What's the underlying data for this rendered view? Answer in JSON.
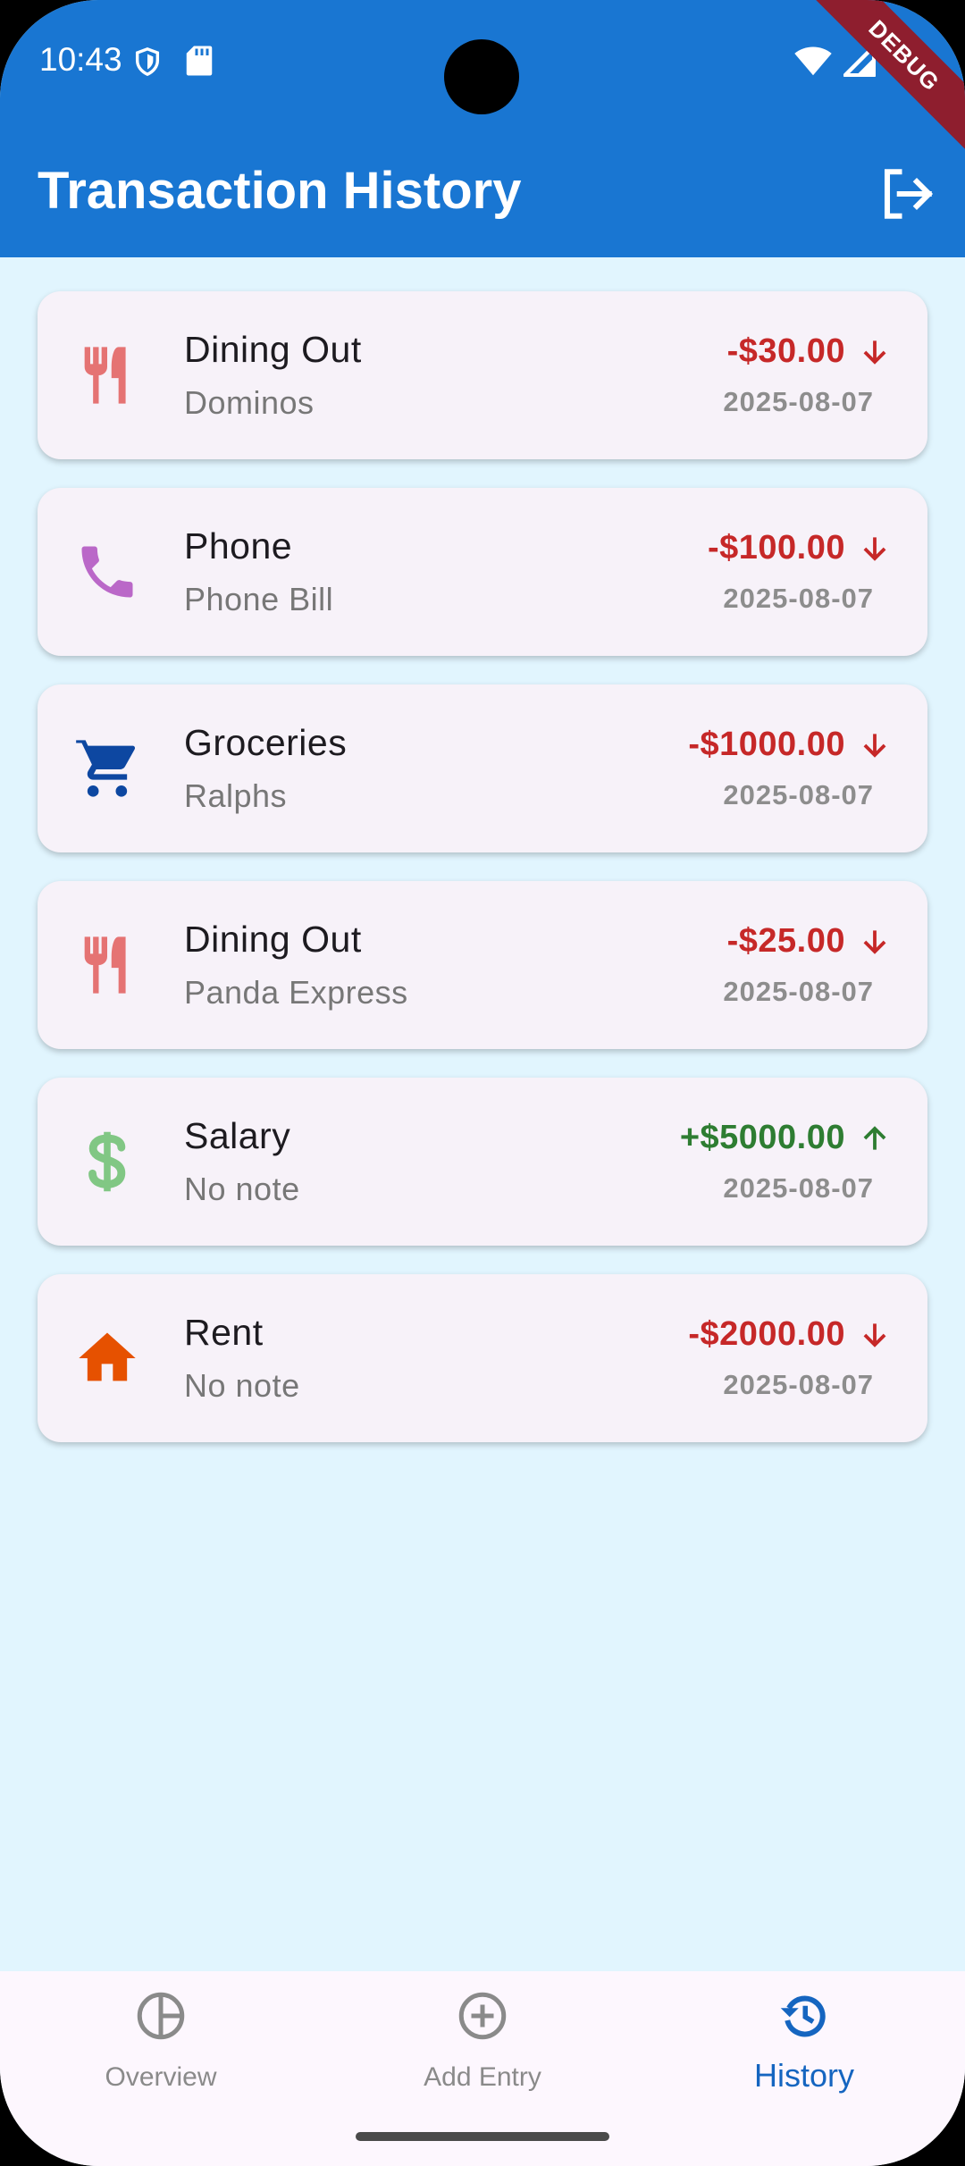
{
  "status_bar": {
    "time": "10:43",
    "icons": [
      "shield-icon",
      "sd-card-icon",
      "wifi-icon",
      "signal-icon"
    ]
  },
  "debug_banner": "DEBUG",
  "app_bar": {
    "title": "Transaction History",
    "action_icon": "logout-icon"
  },
  "colors": {
    "app_bar": "#1976D2",
    "background": "#E1F5FE",
    "card": "#F7F2F9",
    "expense": "#C62828",
    "income": "#2E7D32",
    "nav_active": "#1565C0"
  },
  "transactions": [
    {
      "category": "Dining Out",
      "note": "Dominos",
      "amount": "-$30.00",
      "date": "2025-08-07",
      "type": "expense",
      "icon": "restaurant-icon",
      "icon_color": "#E57373"
    },
    {
      "category": "Phone",
      "note": "Phone Bill",
      "amount": "-$100.00",
      "date": "2025-08-07",
      "type": "expense",
      "icon": "phone-icon",
      "icon_color": "#BA68C8"
    },
    {
      "category": "Groceries",
      "note": "Ralphs",
      "amount": "-$1000.00",
      "date": "2025-08-07",
      "type": "expense",
      "icon": "cart-icon",
      "icon_color": "#0D47A1"
    },
    {
      "category": "Dining Out",
      "note": "Panda Express",
      "amount": "-$25.00",
      "date": "2025-08-07",
      "type": "expense",
      "icon": "restaurant-icon",
      "icon_color": "#E57373"
    },
    {
      "category": "Salary",
      "note": "No note",
      "amount": "+$5000.00",
      "date": "2025-08-07",
      "type": "income",
      "icon": "dollar-icon",
      "icon_color": "#81C784"
    },
    {
      "category": "Rent",
      "note": "No note",
      "amount": "-$2000.00",
      "date": "2025-08-07",
      "type": "expense",
      "icon": "home-icon",
      "icon_color": "#E65100"
    }
  ],
  "bottom_nav": {
    "items": [
      {
        "label": "Overview",
        "icon": "pie-chart-icon",
        "active": false
      },
      {
        "label": "Add Entry",
        "icon": "add-circle-icon",
        "active": false
      },
      {
        "label": "History",
        "icon": "history-icon",
        "active": true
      }
    ]
  }
}
